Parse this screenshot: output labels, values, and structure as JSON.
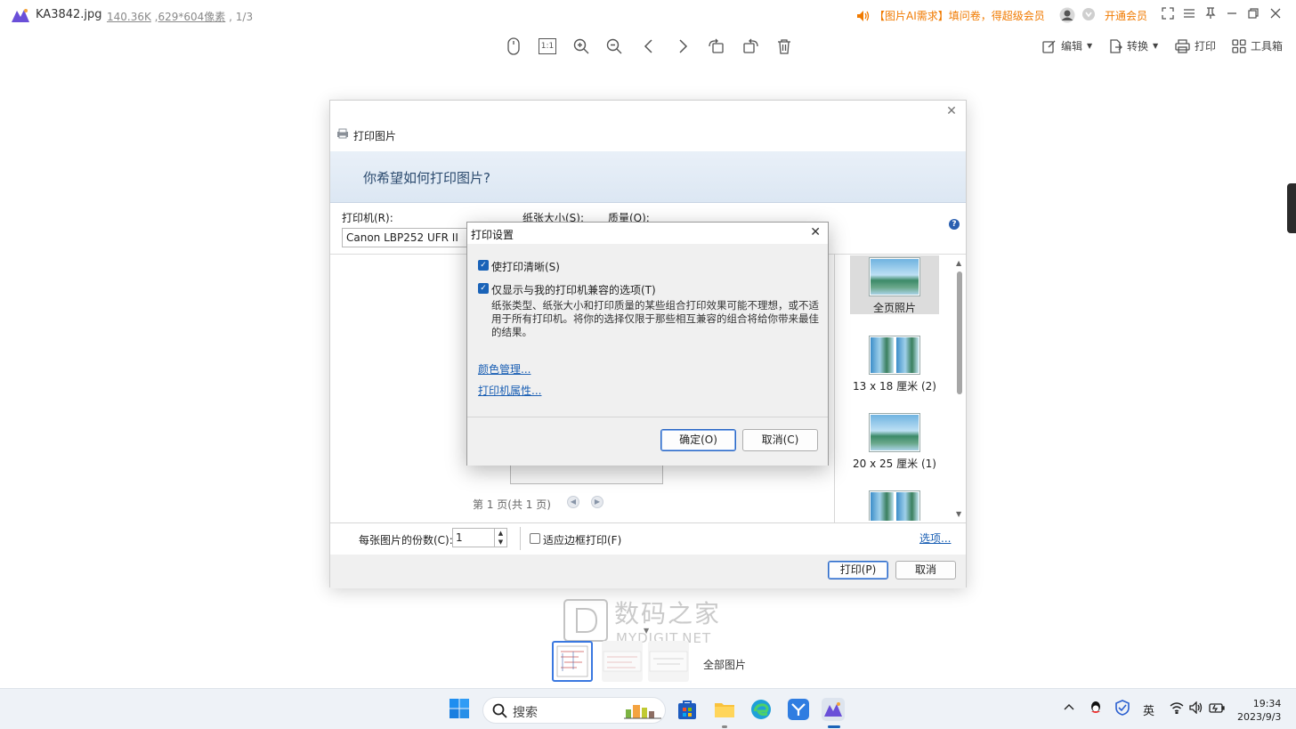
{
  "app": {
    "file_name": "KA3842.jpg",
    "file_size": "140.36K",
    "dimensions": "629*604像素",
    "page_index": "1/3",
    "promo_text": "【图片AI需求】填问卷，得超级会员",
    "vip_label": "开通会员"
  },
  "toolbar": {
    "actual_size_label": "1:1",
    "edit_label": "编辑",
    "convert_label": "转换",
    "print_label": "打印",
    "toolbox_label": "工具箱"
  },
  "print_dialog": {
    "title": "打印图片",
    "question": "你希望如何打印图片?",
    "printer_label": "打印机(R):",
    "printer_value": "Canon LBP252 UFR II",
    "paper_size_label": "纸张大小(S):",
    "quality_label": "质量(Q):",
    "page_info": "第 1 页(共 1 页)",
    "layouts": [
      {
        "label": "全页照片",
        "selected": true
      },
      {
        "label": "13 x 18 厘米 (2)",
        "selected": false
      },
      {
        "label": "20 x 25 厘米 (1)",
        "selected": false
      },
      {
        "label": "",
        "selected": false
      }
    ],
    "copies_label": "每张图片的份数(C):",
    "copies_value": "1",
    "fit_frame_label": "适应边框打印(F)",
    "options_link": "选项...",
    "print_button": "打印(P)",
    "cancel_button": "取消"
  },
  "settings_dialog": {
    "title": "打印设置",
    "sharpen_label": "使打印清晰(S)",
    "sharpen_checked": true,
    "compatible_label": "仅显示与我的打印机兼容的选项(T)",
    "compatible_checked": true,
    "description": "纸张类型、纸张大小和打印质量的某些组合打印效果可能不理想，或不适用于所有打印机。将你的选择仅限于那些相互兼容的组合将给你带来最佳的结果。",
    "color_management_link": "颜色管理...",
    "printer_properties_link": "打印机属性...",
    "ok_button": "确定(O)",
    "cancel_button": "取消(C)"
  },
  "thumbnails": {
    "all_pictures_label": "全部图片"
  },
  "watermark": {
    "cn": "数码之家",
    "en": "MYDIGIT.NET"
  },
  "taskbar": {
    "search_label": "搜索",
    "ime_label": "英",
    "time": "19:34",
    "date": "2023/9/3"
  },
  "colors": {
    "accent": "#2a67c5",
    "promo": "#f07a00",
    "link": "#1a5fb4"
  }
}
